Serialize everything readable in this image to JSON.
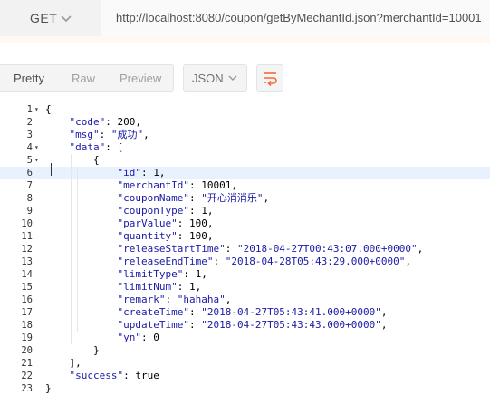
{
  "request": {
    "method": "GET",
    "url": "http://localhost:8080/coupon/getByMechantId.json?merchantId=10001"
  },
  "toolbar": {
    "tabs": [
      "Pretty",
      "Raw",
      "Preview"
    ],
    "active_tab": "Pretty",
    "format": "JSON",
    "wrap_icon": "wrap-lines-icon",
    "accent_color": "#f26b3a"
  },
  "code": {
    "highlighted_line": 6,
    "lines": [
      {
        "n": "1",
        "fold": "▾",
        "parts": [
          {
            "t": "{",
            "c": "p"
          }
        ]
      },
      {
        "n": "2",
        "fold": "",
        "parts": [
          {
            "t": "    ",
            "c": "p"
          },
          {
            "t": "\"code\"",
            "c": "k"
          },
          {
            "t": ": 200,",
            "c": "p"
          }
        ]
      },
      {
        "n": "3",
        "fold": "",
        "parts": [
          {
            "t": "    ",
            "c": "p"
          },
          {
            "t": "\"msg\"",
            "c": "k"
          },
          {
            "t": ": ",
            "c": "p"
          },
          {
            "t": "\"成功\"",
            "c": "s"
          },
          {
            "t": ",",
            "c": "p"
          }
        ]
      },
      {
        "n": "4",
        "fold": "▾",
        "parts": [
          {
            "t": "    ",
            "c": "p"
          },
          {
            "t": "\"data\"",
            "c": "k"
          },
          {
            "t": ": [",
            "c": "p"
          }
        ]
      },
      {
        "n": "5",
        "fold": "▾",
        "parts": [
          {
            "t": "        {",
            "c": "p"
          }
        ]
      },
      {
        "n": "6",
        "fold": "",
        "parts": [
          {
            "t": "            ",
            "c": "p"
          },
          {
            "t": "\"id\"",
            "c": "k"
          },
          {
            "t": ": 1,",
            "c": "p"
          }
        ]
      },
      {
        "n": "7",
        "fold": "",
        "parts": [
          {
            "t": "            ",
            "c": "p"
          },
          {
            "t": "\"merchantId\"",
            "c": "k"
          },
          {
            "t": ": 10001,",
            "c": "p"
          }
        ]
      },
      {
        "n": "8",
        "fold": "",
        "parts": [
          {
            "t": "            ",
            "c": "p"
          },
          {
            "t": "\"couponName\"",
            "c": "k"
          },
          {
            "t": ": ",
            "c": "p"
          },
          {
            "t": "\"开心消消乐\"",
            "c": "s"
          },
          {
            "t": ",",
            "c": "p"
          }
        ]
      },
      {
        "n": "9",
        "fold": "",
        "parts": [
          {
            "t": "            ",
            "c": "p"
          },
          {
            "t": "\"couponType\"",
            "c": "k"
          },
          {
            "t": ": 1,",
            "c": "p"
          }
        ]
      },
      {
        "n": "10",
        "fold": "",
        "parts": [
          {
            "t": "            ",
            "c": "p"
          },
          {
            "t": "\"parValue\"",
            "c": "k"
          },
          {
            "t": ": 100,",
            "c": "p"
          }
        ]
      },
      {
        "n": "11",
        "fold": "",
        "parts": [
          {
            "t": "            ",
            "c": "p"
          },
          {
            "t": "\"quantity\"",
            "c": "k"
          },
          {
            "t": ": 100,",
            "c": "p"
          }
        ]
      },
      {
        "n": "12",
        "fold": "",
        "parts": [
          {
            "t": "            ",
            "c": "p"
          },
          {
            "t": "\"releaseStartTime\"",
            "c": "k"
          },
          {
            "t": ": ",
            "c": "p"
          },
          {
            "t": "\"2018-04-27T00:43:07.000+0000\"",
            "c": "s"
          },
          {
            "t": ",",
            "c": "p"
          }
        ]
      },
      {
        "n": "13",
        "fold": "",
        "parts": [
          {
            "t": "            ",
            "c": "p"
          },
          {
            "t": "\"releaseEndTime\"",
            "c": "k"
          },
          {
            "t": ": ",
            "c": "p"
          },
          {
            "t": "\"2018-04-28T05:43:29.000+0000\"",
            "c": "s"
          },
          {
            "t": ",",
            "c": "p"
          }
        ]
      },
      {
        "n": "14",
        "fold": "",
        "parts": [
          {
            "t": "            ",
            "c": "p"
          },
          {
            "t": "\"limitType\"",
            "c": "k"
          },
          {
            "t": ": 1,",
            "c": "p"
          }
        ]
      },
      {
        "n": "15",
        "fold": "",
        "parts": [
          {
            "t": "            ",
            "c": "p"
          },
          {
            "t": "\"limitNum\"",
            "c": "k"
          },
          {
            "t": ": 1,",
            "c": "p"
          }
        ]
      },
      {
        "n": "16",
        "fold": "",
        "parts": [
          {
            "t": "            ",
            "c": "p"
          },
          {
            "t": "\"remark\"",
            "c": "k"
          },
          {
            "t": ": ",
            "c": "p"
          },
          {
            "t": "\"hahaha\"",
            "c": "s"
          },
          {
            "t": ",",
            "c": "p"
          }
        ]
      },
      {
        "n": "17",
        "fold": "",
        "parts": [
          {
            "t": "            ",
            "c": "p"
          },
          {
            "t": "\"createTime\"",
            "c": "k"
          },
          {
            "t": ": ",
            "c": "p"
          },
          {
            "t": "\"2018-04-27T05:43:41.000+0000\"",
            "c": "s"
          },
          {
            "t": ",",
            "c": "p"
          }
        ]
      },
      {
        "n": "18",
        "fold": "",
        "parts": [
          {
            "t": "            ",
            "c": "p"
          },
          {
            "t": "\"updateTime\"",
            "c": "k"
          },
          {
            "t": ": ",
            "c": "p"
          },
          {
            "t": "\"2018-04-27T05:43:43.000+0000\"",
            "c": "s"
          },
          {
            "t": ",",
            "c": "p"
          }
        ]
      },
      {
        "n": "19",
        "fold": "",
        "parts": [
          {
            "t": "            ",
            "c": "p"
          },
          {
            "t": "\"yn\"",
            "c": "k"
          },
          {
            "t": ": 0",
            "c": "p"
          }
        ]
      },
      {
        "n": "20",
        "fold": "",
        "parts": [
          {
            "t": "        }",
            "c": "p"
          }
        ]
      },
      {
        "n": "21",
        "fold": "",
        "parts": [
          {
            "t": "    ],",
            "c": "p"
          }
        ]
      },
      {
        "n": "22",
        "fold": "",
        "parts": [
          {
            "t": "    ",
            "c": "p"
          },
          {
            "t": "\"success\"",
            "c": "k"
          },
          {
            "t": ": true",
            "c": "p"
          }
        ]
      },
      {
        "n": "23",
        "fold": "",
        "parts": [
          {
            "t": "}",
            "c": "p"
          }
        ]
      }
    ]
  }
}
